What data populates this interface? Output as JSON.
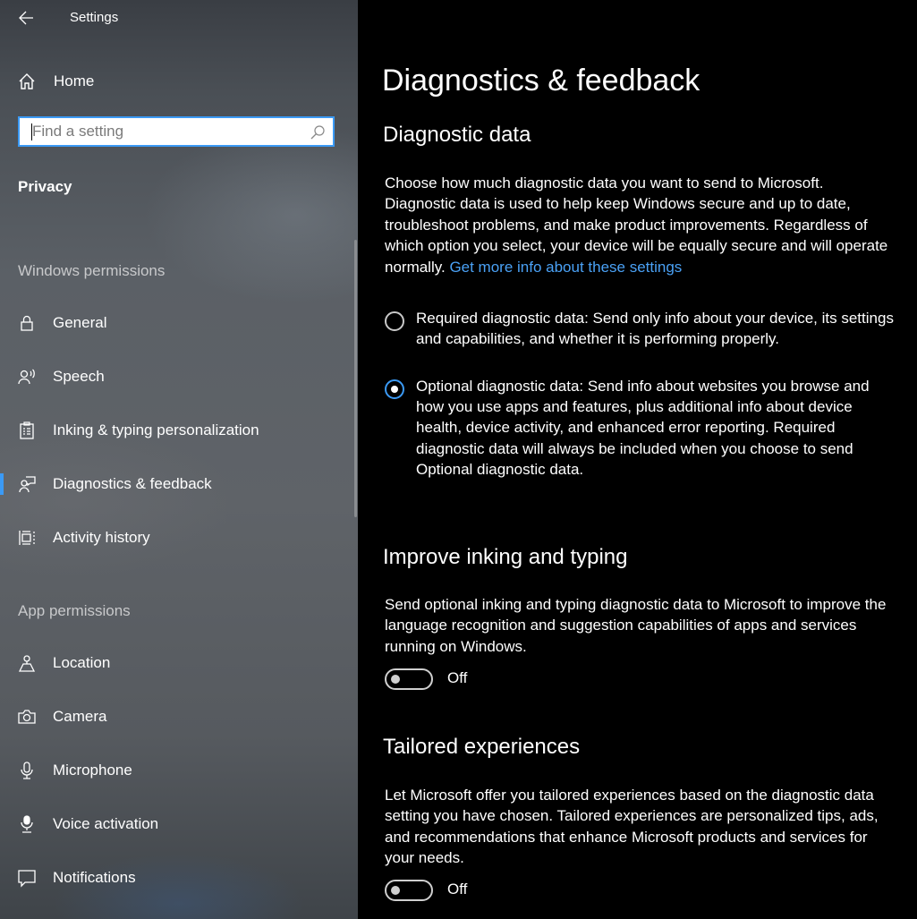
{
  "window": {
    "title": "Settings"
  },
  "sidebar": {
    "home_label": "Home",
    "search_placeholder": "Find a setting",
    "category": "Privacy",
    "sections": [
      {
        "title": "Windows permissions"
      },
      {
        "title": "App permissions"
      }
    ],
    "windows_permissions": [
      {
        "label": "General",
        "icon": "lock-icon"
      },
      {
        "label": "Speech",
        "icon": "speech-icon"
      },
      {
        "label": "Inking & typing personalization",
        "icon": "clipboard-icon"
      },
      {
        "label": "Diagnostics & feedback",
        "icon": "diagnostics-icon",
        "active": true
      },
      {
        "label": "Activity history",
        "icon": "timeline-icon"
      }
    ],
    "app_permissions": [
      {
        "label": "Location",
        "icon": "location-icon"
      },
      {
        "label": "Camera",
        "icon": "camera-icon"
      },
      {
        "label": "Microphone",
        "icon": "microphone-icon"
      },
      {
        "label": "Voice activation",
        "icon": "voice-activation-icon"
      },
      {
        "label": "Notifications",
        "icon": "notifications-icon"
      }
    ],
    "accent_color": "#3b9af5"
  },
  "main": {
    "page_title": "Diagnostics & feedback",
    "diagnostic_data": {
      "heading": "Diagnostic data",
      "description": "Choose how much diagnostic data you want to send to Microsoft. Diagnostic data is used to help keep Windows secure and up to date, troubleshoot problems, and make product improvements. Regardless of which option you select, your device will be equally secure and will operate normally.",
      "link": "Get more info about these settings",
      "options": [
        {
          "label": "Required diagnostic data: Send only info about your device, its settings and capabilities, and whether it is performing properly.",
          "selected": false
        },
        {
          "label": "Optional diagnostic data: Send info about websites you browse and how you use apps and features, plus additional info about device health, device activity, and enhanced error reporting. Required diagnostic data will always be included when you choose to send Optional diagnostic data.",
          "selected": true
        }
      ]
    },
    "inking": {
      "heading": "Improve inking and typing",
      "description": "Send optional inking and typing diagnostic data to Microsoft to improve the language recognition and suggestion capabilities of apps and services running on Windows.",
      "toggle_state": "Off"
    },
    "tailored": {
      "heading": "Tailored experiences",
      "description": "Let Microsoft offer you tailored experiences based on the diagnostic data setting you have chosen. Tailored experiences are personalized tips, ads, and recommendations that enhance Microsoft products and services for your needs.",
      "toggle_state": "Off"
    },
    "link_color": "#4aa1f5"
  }
}
